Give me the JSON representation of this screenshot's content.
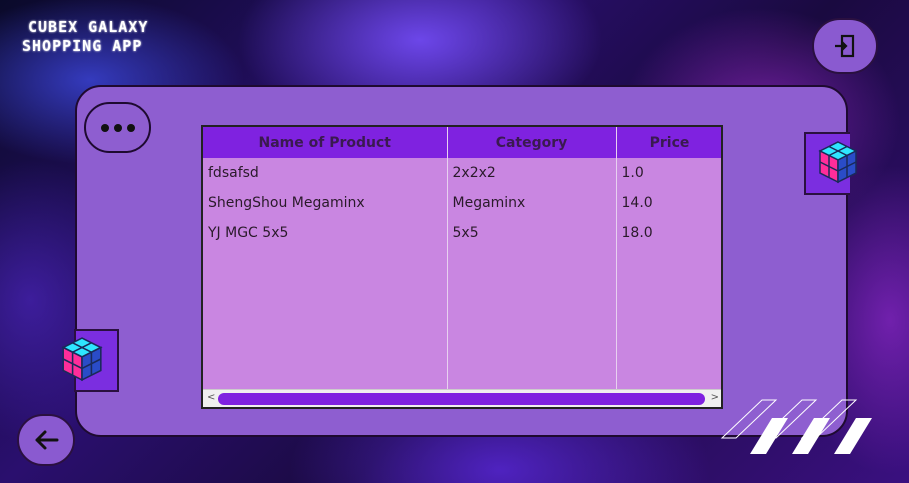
{
  "app": {
    "title_line1": "Cubex Galaxy",
    "title_line2": "Shopping App"
  },
  "icons": {
    "exit": "logout-icon",
    "back": "arrow-left-icon",
    "menu": "more-horizontal-icon",
    "cube": "rubiks-cube-icon"
  },
  "colors": {
    "panel": "#8e5ed0",
    "header": "#7f22e0",
    "table_bg": "#c986e1",
    "cube_pink": "#ff2d9a",
    "cube_cyan": "#2ee6ff"
  },
  "table": {
    "columns": [
      "Name of Product",
      "Category",
      "Price"
    ],
    "rows": [
      [
        "fdsafsd",
        "2x2x2",
        "1.0"
      ],
      [
        "ShengShou Megaminx",
        "Megaminx",
        "14.0"
      ],
      [
        "YJ MGC 5x5",
        "5x5",
        "18.0"
      ]
    ],
    "scroll_left_arrow": "<",
    "scroll_right_arrow": ">"
  }
}
